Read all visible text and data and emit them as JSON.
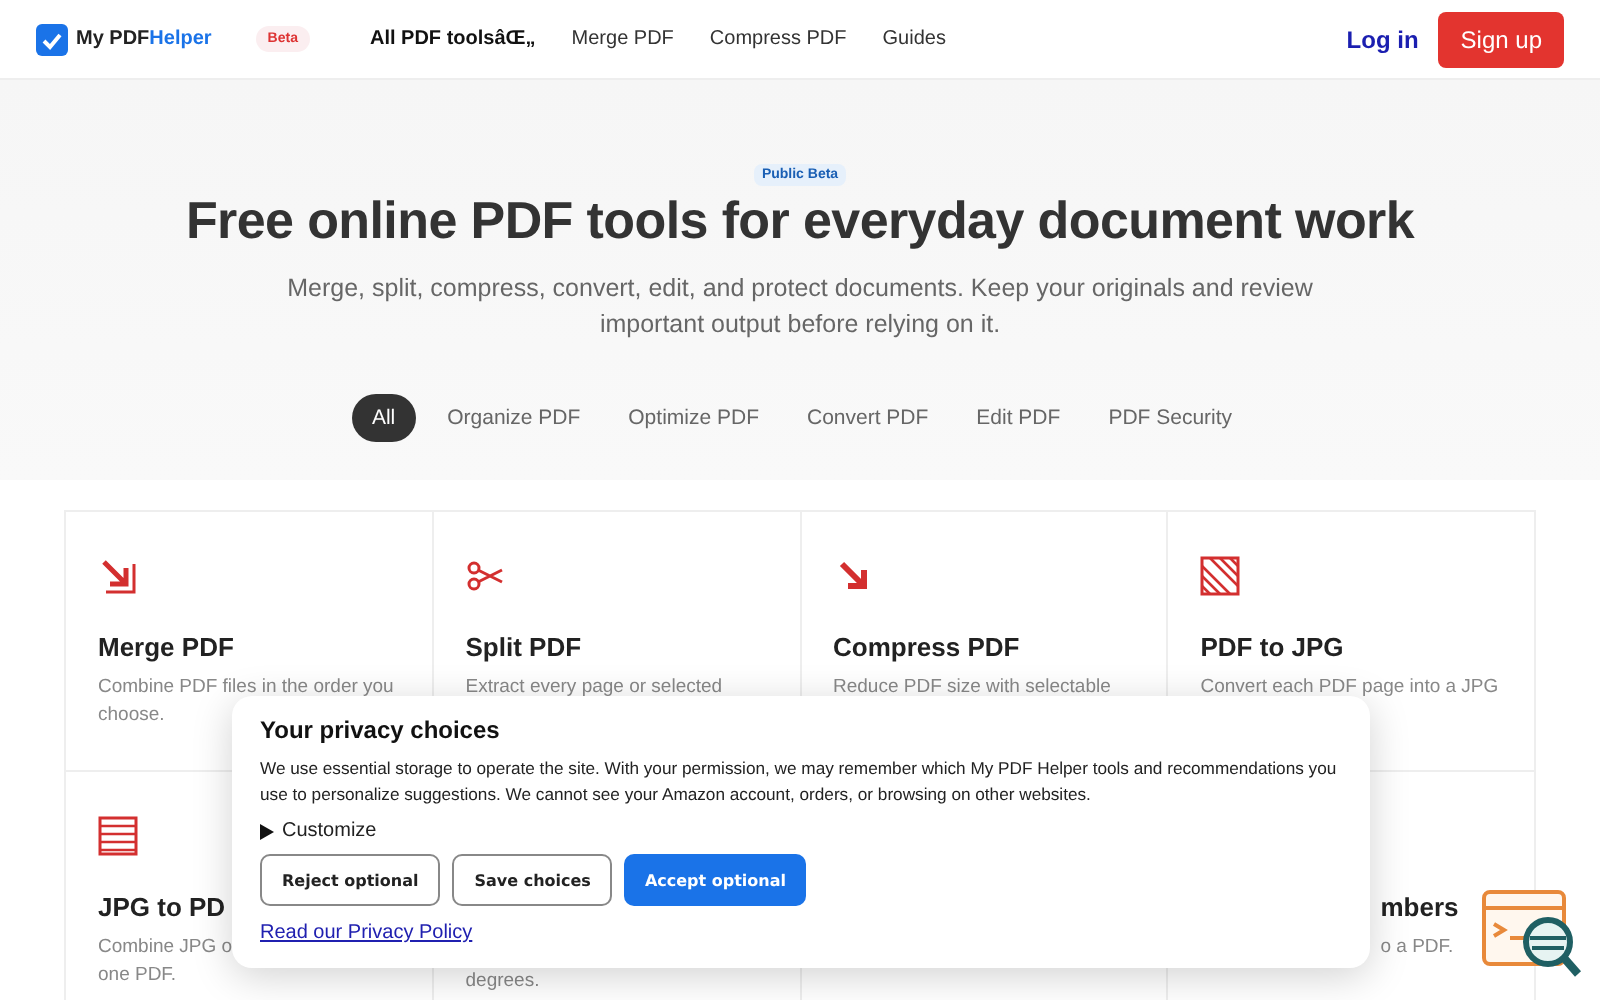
{
  "header": {
    "brand": {
      "main": "My PDF",
      "accent": "Helper"
    },
    "badge": "Beta",
    "nav": [
      {
        "label": "All PDF toolsâŒ„"
      },
      {
        "label": "Merge PDF"
      },
      {
        "label": "Compress PDF"
      },
      {
        "label": "Guides"
      }
    ],
    "login": "Log in",
    "signup": "Sign up"
  },
  "hero": {
    "badge": "Public Beta",
    "title": "Free online PDF tools for everyday document work",
    "subtitle": "Merge, split, compress, convert, edit, and protect documents. Keep your originals and review important output before relying on it."
  },
  "filters": [
    {
      "label": "All",
      "selected": true
    },
    {
      "label": "Organize PDF",
      "selected": false
    },
    {
      "label": "Optimize PDF",
      "selected": false
    },
    {
      "label": "Convert PDF",
      "selected": false
    },
    {
      "label": "Edit PDF",
      "selected": false
    },
    {
      "label": "PDF Security",
      "selected": false
    }
  ],
  "cards": [
    {
      "kind": "merge",
      "title": "Merge PDF",
      "description": "Combine PDF files in the order you choose."
    },
    {
      "kind": "scissors",
      "title": "Split PDF",
      "description": "Extract every page or selected"
    },
    {
      "kind": "compress",
      "title": "Compress PDF",
      "description": "Reduce PDF size with selectable"
    },
    {
      "kind": "stripes",
      "title": "PDF to JPG",
      "description": "Convert each PDF page into a JPG"
    },
    {
      "kind": "lines",
      "title": "JPG to PD",
      "description": "Combine JPG o\none PDF."
    },
    {
      "description": "degrees."
    },
    {
      "title": "mbers",
      "description": "o a PDF.",
      "cut": true
    }
  ],
  "privacy": {
    "title": "Your privacy choices",
    "text": "We use essential storage to operate the site. With your permission, we may remember which My PDF Helper tools and recommendations you use to personalize suggestions. We cannot see your Amazon account, orders, or browsing on other websites.",
    "customize": "Customize",
    "expanded": false,
    "buttons": [
      {
        "label": "Reject optional",
        "kind": "outline"
      },
      {
        "label": "Save choices",
        "kind": "outline"
      },
      {
        "label": "Accept optional",
        "kind": "primary"
      }
    ],
    "link": "Read our Privacy Policy"
  }
}
